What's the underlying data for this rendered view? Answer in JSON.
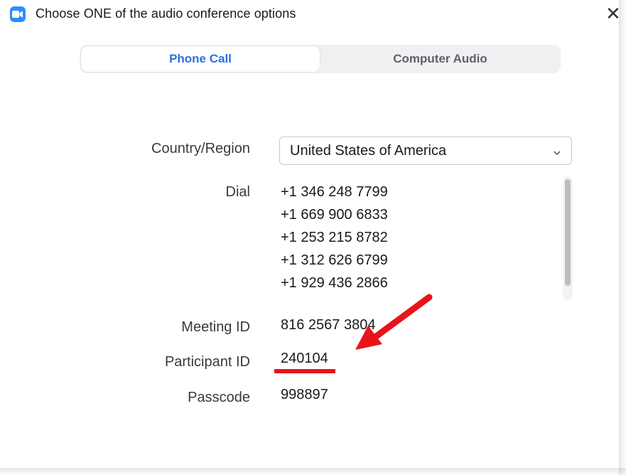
{
  "window": {
    "title": "Choose ONE of the audio conference options",
    "close_glyph": "✕"
  },
  "tabs": [
    {
      "label": "Phone Call",
      "active": true
    },
    {
      "label": "Computer Audio",
      "active": false
    }
  ],
  "form": {
    "country_label": "Country/Region",
    "country_value": "United States of America",
    "dial_label": "Dial",
    "dial_numbers": [
      "+1 346 248 7799",
      "+1 669 900 6833",
      "+1 253 215 8782",
      "+1 312 626 6799",
      "+1 929 436 2866"
    ],
    "meeting_id_label": "Meeting ID",
    "meeting_id_value": "816 2567 3804",
    "participant_id_label": "Participant ID",
    "participant_id_value": "240104",
    "passcode_label": "Passcode",
    "passcode_value": "998897"
  },
  "icons": {
    "app": "zoom-camera-icon",
    "close": "close-icon",
    "dropdown": "chevron-down-icon"
  },
  "colors": {
    "accent": "#2d6fe0",
    "app_icon": "#2d8cff",
    "annotation": "#e8141b"
  }
}
